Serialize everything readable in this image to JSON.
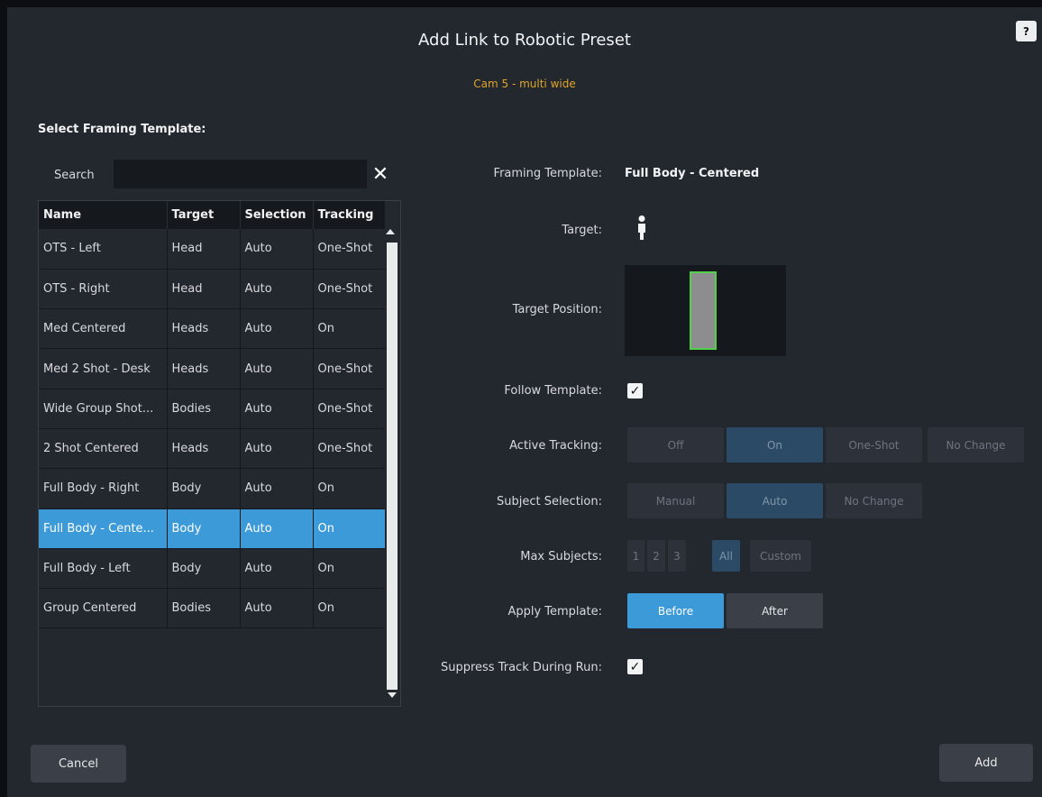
{
  "dialog": {
    "title": "Add Link to Robotic Preset",
    "subtitle": "Cam 5 - multi wide",
    "help_label": "?"
  },
  "left": {
    "section_label": "Select Framing Template:",
    "search_label": "Search",
    "search_value": "",
    "clear_icon": "close-icon",
    "columns": [
      "Name",
      "Target",
      "Selection",
      "Tracking"
    ],
    "rows": [
      {
        "name": "OTS - Left",
        "target": "Head",
        "selection": "Auto",
        "tracking": "One-Shot"
      },
      {
        "name": "OTS - Right",
        "target": "Head",
        "selection": "Auto",
        "tracking": "One-Shot"
      },
      {
        "name": "Med Centered",
        "target": "Heads",
        "selection": "Auto",
        "tracking": "On"
      },
      {
        "name": "Med 2 Shot - Desk",
        "target": "Heads",
        "selection": "Auto",
        "tracking": "One-Shot"
      },
      {
        "name": "Wide Group Shot...",
        "target": "Bodies",
        "selection": "Auto",
        "tracking": "One-Shot"
      },
      {
        "name": "2 Shot Centered",
        "target": "Heads",
        "selection": "Auto",
        "tracking": "One-Shot"
      },
      {
        "name": "Full Body - Right",
        "target": "Body",
        "selection": "Auto",
        "tracking": "On"
      },
      {
        "name": "Full Body - Cente...",
        "target": "Body",
        "selection": "Auto",
        "tracking": "On"
      },
      {
        "name": "Full Body - Left",
        "target": "Body",
        "selection": "Auto",
        "tracking": "On"
      },
      {
        "name": "Group Centered",
        "target": "Bodies",
        "selection": "Auto",
        "tracking": "On"
      }
    ],
    "selected_row": 7
  },
  "right": {
    "framing_template_label": "Framing Template:",
    "framing_template_value": "Full Body - Centered",
    "target_label": "Target:",
    "target_icon": "person-icon",
    "target_position_label": "Target Position:",
    "follow_template_label": "Follow Template:",
    "follow_template_checked": true,
    "active_tracking_label": "Active Tracking:",
    "active_tracking_options": [
      "Off",
      "On",
      "One-Shot",
      "No Change"
    ],
    "active_tracking_selected": "On",
    "subject_selection_label": "Subject Selection:",
    "subject_selection_options": [
      "Manual",
      "Auto",
      "No Change"
    ],
    "subject_selection_selected": "Auto",
    "max_subjects_label": "Max Subjects:",
    "max_subjects_options": [
      "1",
      "2",
      "3",
      "All",
      "Custom"
    ],
    "max_subjects_selected": "All",
    "apply_template_label": "Apply Template:",
    "apply_template_options": [
      "Before",
      "After"
    ],
    "apply_template_selected": "Before",
    "suppress_label": "Suppress Track During Run:",
    "suppress_checked": true
  },
  "footer": {
    "cancel_label": "Cancel",
    "add_label": "Add"
  },
  "colors": {
    "accent": "#3d9ad8",
    "subtitle": "#e0a52a",
    "target_outline": "#54d04c"
  }
}
